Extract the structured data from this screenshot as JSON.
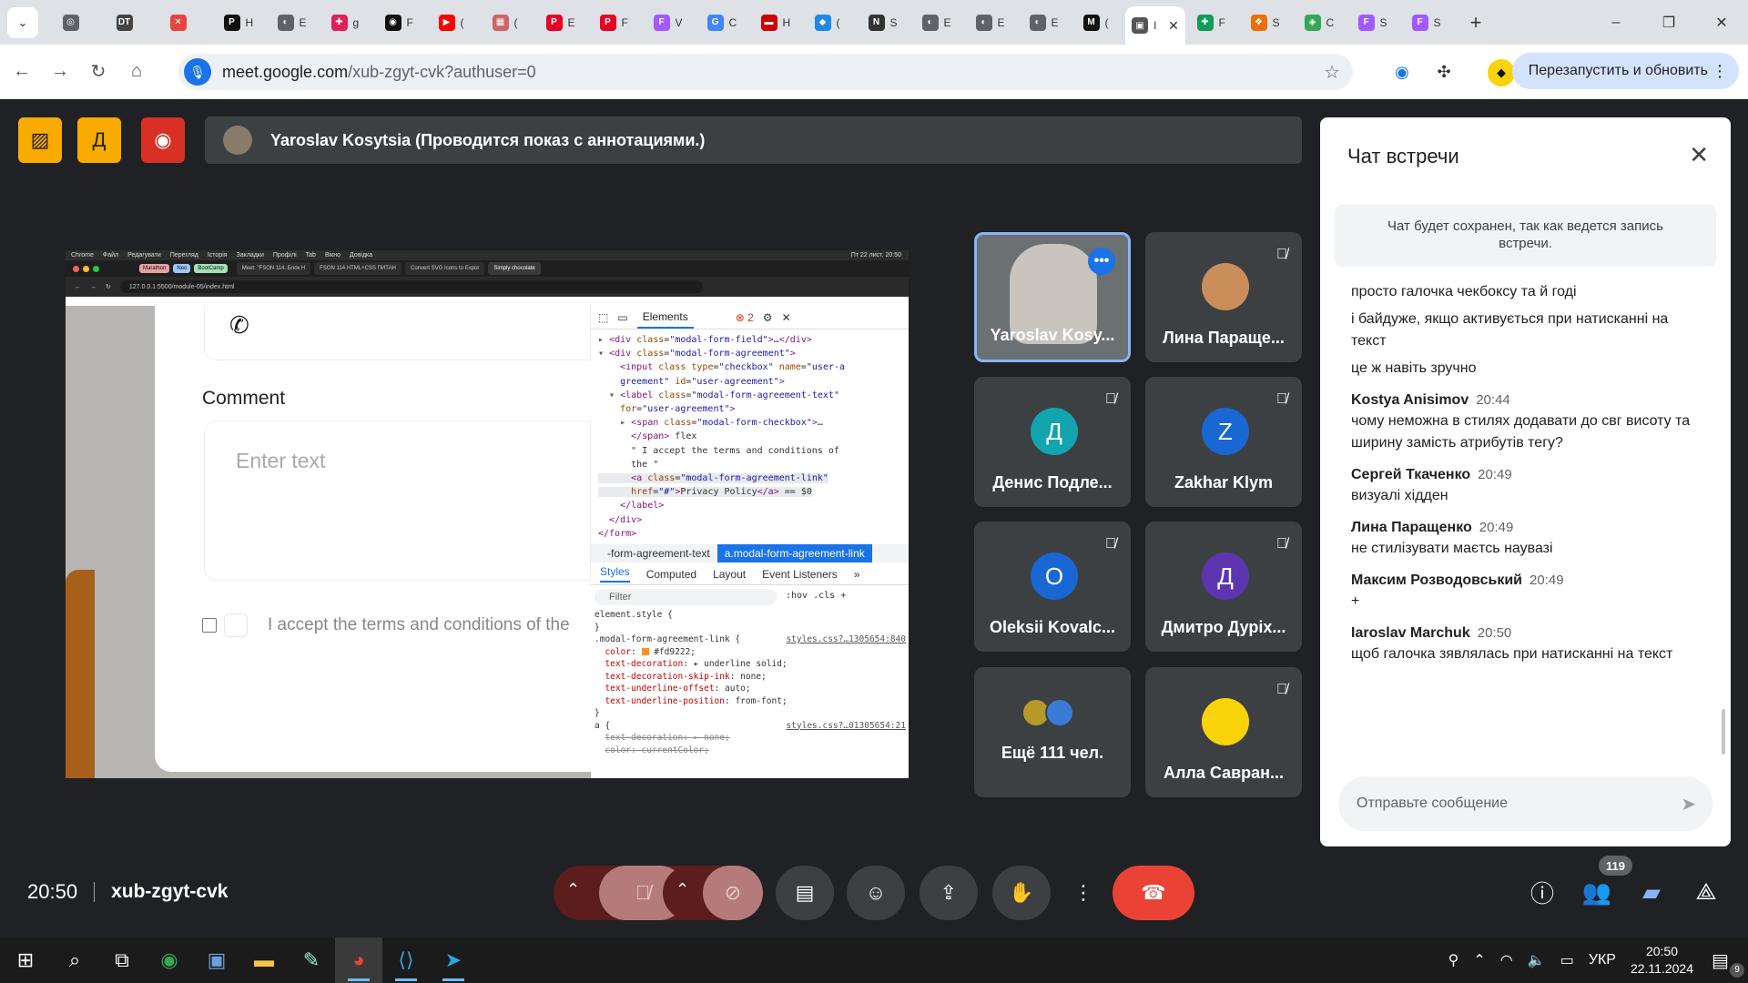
{
  "browser": {
    "tab_search_icon": "chevron-down-icon",
    "tabs": [
      {
        "fav": "◎",
        "color": "#5f6368",
        "label": ""
      },
      {
        "fav": "DT",
        "color": "#444",
        "label": ""
      },
      {
        "fav": "✕",
        "color": "#e8453c",
        "label": ""
      },
      {
        "fav": "P",
        "color": "#111",
        "label": "H"
      },
      {
        "fav": "◐",
        "color": "#5f6368",
        "label": "E"
      },
      {
        "fav": "✚",
        "color": "#e01e5a",
        "label": "g"
      },
      {
        "fav": "◉",
        "color": "#111",
        "label": "F"
      },
      {
        "fav": "▶",
        "color": "#ff0000",
        "label": "("
      },
      {
        "fav": "▦",
        "color": "#c66",
        "label": "("
      },
      {
        "fav": "P",
        "color": "#e60023",
        "label": "E"
      },
      {
        "fav": "P",
        "color": "#e60023",
        "label": "F"
      },
      {
        "fav": "F",
        "color": "#a259ff",
        "label": "V"
      },
      {
        "fav": "G",
        "color": "#4285f4",
        "label": "C"
      },
      {
        "fav": "▬",
        "color": "#c00",
        "label": "H"
      },
      {
        "fav": "◆",
        "color": "#1e88e5",
        "label": "("
      },
      {
        "fav": "N",
        "color": "#333",
        "label": "S"
      },
      {
        "fav": "◐",
        "color": "#5f6368",
        "label": "E"
      },
      {
        "fav": "◐",
        "color": "#5f6368",
        "label": "E"
      },
      {
        "fav": "◐",
        "color": "#5f6368",
        "label": "E"
      },
      {
        "fav": "M",
        "color": "#111",
        "label": "("
      }
    ],
    "active_tab": {
      "fav": "▣",
      "label": "I"
    },
    "tabs_after": [
      {
        "fav": "✚",
        "color": "#0f9d58",
        "label": "F"
      },
      {
        "fav": "❖",
        "color": "#e8710a",
        "label": "S"
      },
      {
        "fav": "◈",
        "color": "#34a853",
        "label": "C"
      },
      {
        "fav": "F",
        "color": "#a259ff",
        "label": "S"
      },
      {
        "fav": "F",
        "color": "#a259ff",
        "label": "S"
      }
    ],
    "new_tab": "+",
    "window_controls": [
      "–",
      "❐",
      "✕"
    ],
    "url_host": "meet.google.com",
    "url_path": "/xub-zgyt-cvk?authuser=0",
    "relaunch_label": "Перезапустить и обновить",
    "menu_dots": "⋮"
  },
  "meet": {
    "presenter_text": "Yaroslav Kosytsia (Проводится показ с аннотациями.)",
    "top_buttons": [
      {
        "icon": "▨",
        "bg": "#f9ab00",
        "color": "#202124"
      },
      {
        "icon": "Д",
        "bg": "#f9ab00",
        "color": "#202124"
      },
      {
        "icon": "◉",
        "bg": "#d93025",
        "color": "#fff"
      }
    ],
    "meeting_time": "20:50",
    "meeting_code": "xub-zgyt-cvk",
    "people_count": "119"
  },
  "shared_screen": {
    "mac_menu": [
      "Chrome",
      "Файл",
      "Редагувати",
      "Перегляд",
      "Історія",
      "Закладки",
      "Профілі",
      "Tab",
      "Вікно",
      "Довідка"
    ],
    "mac_clock": "Пт 22 лист. 20:50",
    "inner_pills": [
      {
        "label": "Marathon",
        "color": "#e8a0a0"
      },
      {
        "label": "Neo",
        "color": "#9ec5f8"
      },
      {
        "label": "BootCamp",
        "color": "#a4e0b8"
      }
    ],
    "inner_tabs": [
      "Meet: \"FSON 114..Блок Н",
      "FSON 114 HTML+CSS ПИТАН",
      "Convert SVG Icons to Expor",
      "Simply chocolate"
    ],
    "inner_url": "127.0.0.1:5500/module-05/index.html",
    "comment_label": "Comment",
    "comment_placeholder": "Enter text",
    "agree_text": "I accept the terms and conditions of the",
    "devtools": {
      "elements_tab": "Elements",
      "error_count": "2",
      "crumb_1": "-form-agreement-text",
      "crumb_2": "a.modal-form-agreement-link",
      "subtabs": [
        "Styles",
        "Computed",
        "Layout",
        "Event Listeners",
        "»"
      ],
      "filter_placeholder": "Filter",
      "filter_tools": ":hov  .cls  +",
      "src_1": "styles.css?…1305654:840",
      "src_2": "styles.css?…01305654:21"
    }
  },
  "participants": [
    {
      "name": "Yaroslav Kosy...",
      "type": "video"
    },
    {
      "name": "Лина Параще...",
      "type": "photo",
      "color": "#c98e5a"
    },
    {
      "name": "Денис Подле...",
      "type": "letter",
      "letter": "Д",
      "color": "#12a4af"
    },
    {
      "name": "Zakhar Klym",
      "type": "letter",
      "letter": "Z",
      "color": "#1967d2"
    },
    {
      "name": "Oleksii Kovalc...",
      "type": "letter",
      "letter": "O",
      "color": "#1967d2"
    },
    {
      "name": "Дмитро Дуріх...",
      "type": "letter",
      "letter": "Д",
      "color": "#5e35b1"
    },
    {
      "name": "Ещё 111 чел.",
      "type": "more"
    },
    {
      "name": "Алла Савран...",
      "type": "photo",
      "color": "#f9d30a"
    }
  ],
  "chat": {
    "title": "Чат встречи",
    "notice": "Чат будет сохранен, так как ведется запись встречи.",
    "lead_lines": [
      "просто галочка чекбоксу та й годі",
      "і байдуже, якщо активується при натисканні на текст",
      "це ж навіть зручно"
    ],
    "messages": [
      {
        "author": "Kostya Anisimov",
        "time": "20:44",
        "text": "чому неможна в стилях додавати до свг висоту та ширину замість атрибутів тегу?"
      },
      {
        "author": "Сергей Ткаченко",
        "time": "20:49",
        "text": "визуалі хідден"
      },
      {
        "author": "Лина Паращенко",
        "time": "20:49",
        "text": "не стилізувати маєтсь наувазі"
      },
      {
        "author": "Максим Розводовський",
        "time": "20:49",
        "text": "+"
      },
      {
        "author": "Iaroslav Marchuk",
        "time": "20:50",
        "text": "щоб галочка зявлялась при натисканні на текст"
      }
    ],
    "input_placeholder": "Отправьте сообщение"
  },
  "taskbar": {
    "lang": "УКР",
    "time": "20:50",
    "date": "22.11.2024",
    "notif_count": "9"
  }
}
